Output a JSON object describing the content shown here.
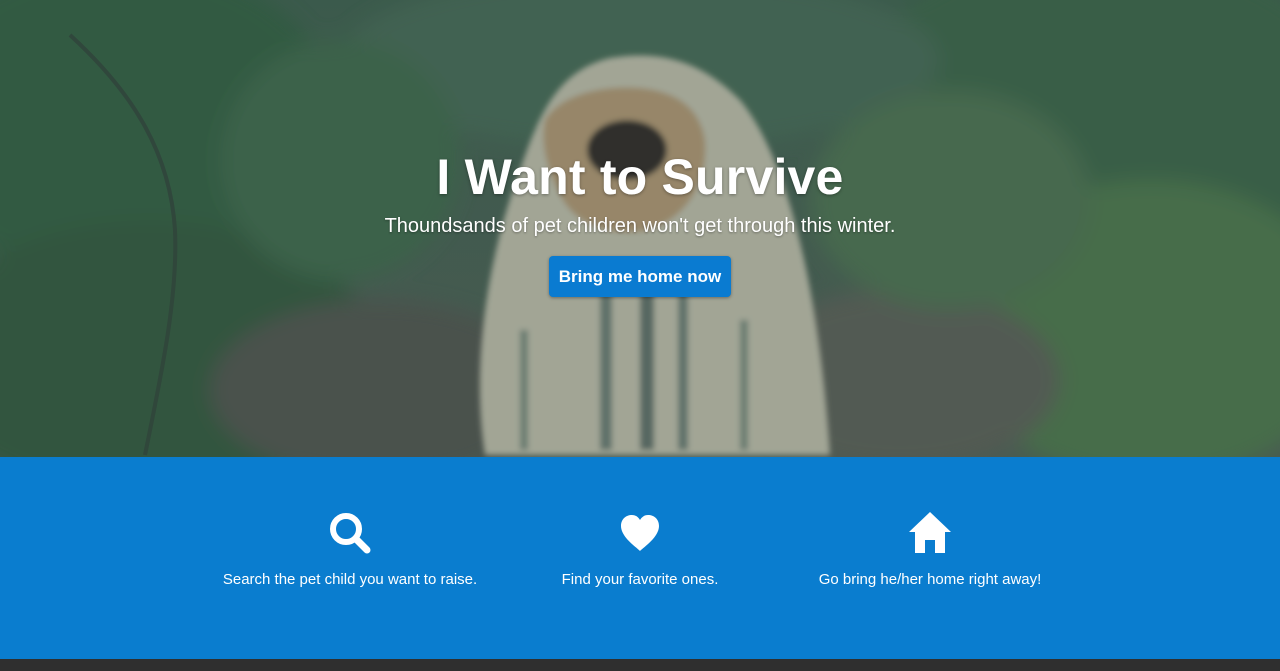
{
  "hero": {
    "title": "I Want to Survive",
    "subtitle": "Thoundsands of pet children won't get through this winter.",
    "cta_label": "Bring me home now"
  },
  "features": [
    {
      "icon": "search-icon",
      "label": "Search the pet child you want to raise."
    },
    {
      "icon": "heart-icon",
      "label": "Find your favorite ones."
    },
    {
      "icon": "home-icon",
      "label": "Go bring he/her home right away!"
    }
  ],
  "colors": {
    "accent": "#0a7dcf",
    "button": "#0a7bd1",
    "footer": "#2f2f2f"
  }
}
